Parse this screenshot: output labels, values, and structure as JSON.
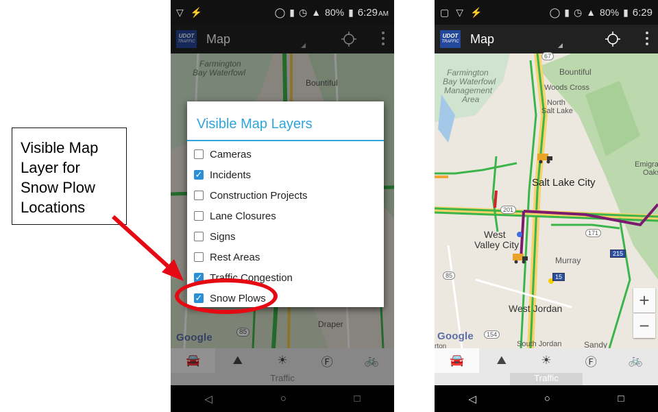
{
  "callout": {
    "lines": [
      "Visible Map",
      "Layer for",
      "Snow Plow",
      "Locations"
    ]
  },
  "colors": {
    "accent": "#2fa4dc",
    "checkbox": "#2a8fd6",
    "highlight": "#e50914",
    "route": "#7b1a6e",
    "traffic_green": "#3bb54a"
  },
  "status_bar": {
    "battery": "80%",
    "time": "6:29",
    "ampm": "AM"
  },
  "app_bar": {
    "logo_line1": "UDOT",
    "logo_line2": "TRAFFIC",
    "title": "Map"
  },
  "dialog": {
    "title": "Visible Map Layers",
    "layers": [
      {
        "label": "Cameras",
        "checked": false
      },
      {
        "label": "Incidents",
        "checked": true
      },
      {
        "label": "Construction Projects",
        "checked": false
      },
      {
        "label": "Lane Closures",
        "checked": false
      },
      {
        "label": "Signs",
        "checked": false
      },
      {
        "label": "Rest Areas",
        "checked": false
      },
      {
        "label": "Traffic Congestion",
        "checked": true
      },
      {
        "label": "Snow Plows",
        "checked": true
      }
    ]
  },
  "map_left": {
    "labels": {
      "farmington": "Farmington",
      "bay_waterfowl": "Bay Waterfowl",
      "bountiful": "Bountiful",
      "draper": "Draper",
      "route_85": "85"
    },
    "google": "Google"
  },
  "map_right": {
    "labels": {
      "farmington": "Farmington",
      "bay_waterfowl": "Bay Waterfowl",
      "management": "Management",
      "area": "Area",
      "bountiful": "Bountiful",
      "woods_cross": "Woods Cross",
      "north": "North",
      "salt_lake": "Salt Lake",
      "salt_lake_city": "Salt Lake City",
      "emigration": "Emigrat",
      "oaks": "Oaks",
      "west": "West",
      "valley_city": "Valley City",
      "murray": "Murray",
      "west_jordan": "West Jordan",
      "south_jordan": "South Jordan",
      "sandy": "Sandy",
      "ton": "rton",
      "r67": "67",
      "r201": "201",
      "r171": "171",
      "r215": "215",
      "r15": "15",
      "r85": "85",
      "r154": "154"
    },
    "google": "Google",
    "zoom_in": "+",
    "zoom_out": "−"
  },
  "bottom_tabs": {
    "icons": [
      "car-icon",
      "mountain-pass-icon",
      "weather-icon",
      "fz-icon",
      "bicycle-icon"
    ],
    "glyphs": [
      "🚘",
      "⛰",
      "☀",
      "Ⓕ",
      "🚲"
    ],
    "caption": "Traffic"
  },
  "nav_bar": {
    "back": "◁",
    "home": "○",
    "recents": "□"
  }
}
